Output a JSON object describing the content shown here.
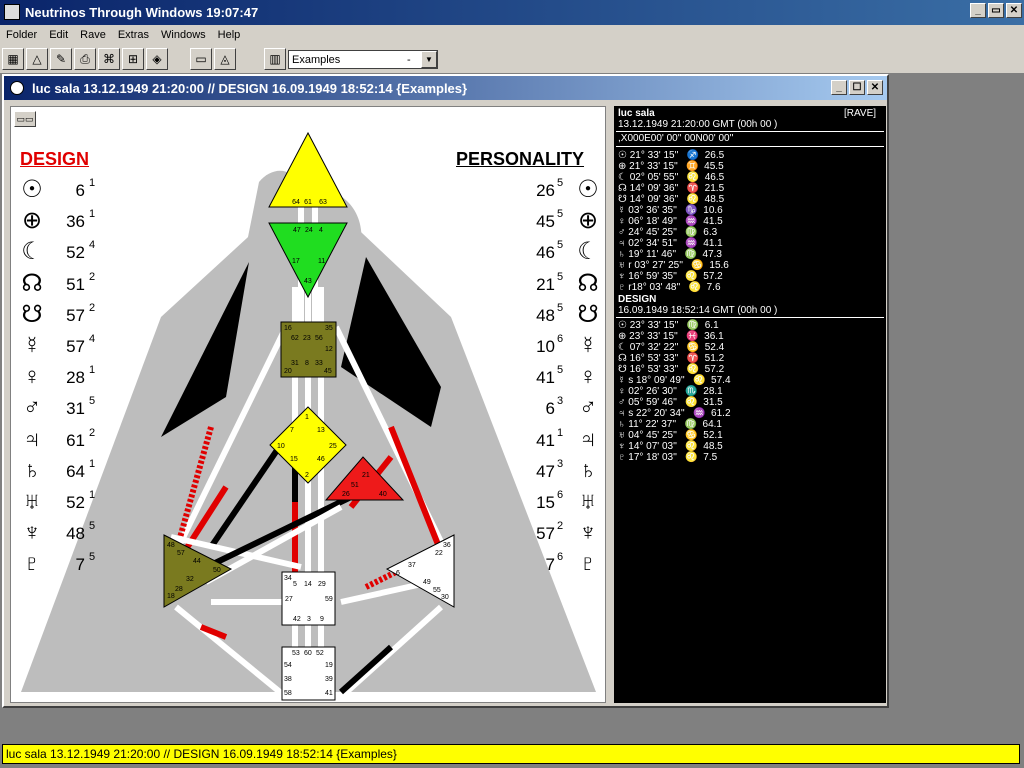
{
  "app": {
    "title": "Neutrinos Through Windows 19:07:47"
  },
  "menu": [
    "Folder",
    "Edit",
    "Rave",
    "Extras",
    "Windows",
    "Help"
  ],
  "toolbar": {
    "examples_value": "Examples",
    "examples_dash": "-"
  },
  "child": {
    "title": "luc sala 13.12.1949 21:20:00 // DESIGN 16.09.1949 18:52:14  {Examples}"
  },
  "chart": {
    "design_label": "DESIGN",
    "personality_label": "PERSONALITY",
    "design": [
      {
        "glyph": "sun-icon",
        "gate": "6",
        "line": "1"
      },
      {
        "glyph": "earth-icon",
        "gate": "36",
        "line": "1"
      },
      {
        "glyph": "moon-icon",
        "gate": "52",
        "line": "4"
      },
      {
        "glyph": "north-node-icon",
        "gate": "51",
        "line": "2"
      },
      {
        "glyph": "south-node-icon",
        "gate": "57",
        "line": "2"
      },
      {
        "glyph": "mercury-icon",
        "gate": "57",
        "line": "4"
      },
      {
        "glyph": "venus-icon",
        "gate": "28",
        "line": "1"
      },
      {
        "glyph": "mars-icon",
        "gate": "31",
        "line": "5"
      },
      {
        "glyph": "jupiter-icon",
        "gate": "61",
        "line": "2"
      },
      {
        "glyph": "saturn-icon",
        "gate": "64",
        "line": "1"
      },
      {
        "glyph": "uranus-icon",
        "gate": "52",
        "line": "1"
      },
      {
        "glyph": "neptune-icon",
        "gate": "48",
        "line": "5"
      },
      {
        "glyph": "pluto-icon",
        "gate": "7",
        "line": "5"
      }
    ],
    "personality": [
      {
        "glyph": "sun-icon",
        "gate": "26",
        "line": "5"
      },
      {
        "glyph": "earth-icon",
        "gate": "45",
        "line": "5"
      },
      {
        "glyph": "moon-icon",
        "gate": "46",
        "line": "5"
      },
      {
        "glyph": "north-node-icon",
        "gate": "21",
        "line": "5"
      },
      {
        "glyph": "south-node-icon",
        "gate": "48",
        "line": "5"
      },
      {
        "glyph": "mercury-icon",
        "gate": "10",
        "line": "6"
      },
      {
        "glyph": "venus-icon",
        "gate": "41",
        "line": "5"
      },
      {
        "glyph": "mars-icon",
        "gate": "6",
        "line": "3"
      },
      {
        "glyph": "jupiter-icon",
        "gate": "41",
        "line": "1"
      },
      {
        "glyph": "saturn-icon",
        "gate": "47",
        "line": "3"
      },
      {
        "glyph": "uranus-icon",
        "gate": "15",
        "line": "6"
      },
      {
        "glyph": "neptune-icon",
        "gate": "57",
        "line": "2"
      },
      {
        "glyph": "pluto-icon",
        "gate": "7",
        "line": "6"
      }
    ],
    "centers": {
      "head": [
        "64",
        "61",
        "63"
      ],
      "ajna": [
        "47",
        "24",
        "4",
        "17",
        "11",
        "43"
      ],
      "throat": [
        "16",
        "62",
        "23",
        "56",
        "35",
        "12",
        "31",
        "8",
        "33",
        "20",
        "45"
      ],
      "g": [
        "1",
        "7",
        "13",
        "10",
        "25",
        "15",
        "46",
        "2"
      ],
      "ego": [
        "21",
        "51",
        "26",
        "40"
      ],
      "spleen": [
        "48",
        "57",
        "44",
        "50",
        "32",
        "28",
        "18"
      ],
      "sacral": [
        "34",
        "5",
        "14",
        "29",
        "27",
        "59",
        "42",
        "3",
        "9"
      ],
      "solar": [
        "36",
        "22",
        "37",
        "6",
        "49",
        "55",
        "30"
      ],
      "root": [
        "53",
        "60",
        "52",
        "54",
        "19",
        "38",
        "39",
        "58",
        "41"
      ]
    }
  },
  "panel": {
    "name": "luc sala",
    "rave_tag": "[RAVE]",
    "personality_date": "13.12.1949  21:20:00  GMT (00h 00 )",
    "coords": ",X000E00' 00''  00N00' 00''",
    "personality_rows": [
      "21° 33' 15''   ♐  26.5",
      "21° 33' 15''   ♊  45.5",
      "02° 05' 55''   ♌  46.5",
      "14° 09' 36''   ♈  21.5",
      "14° 09' 36''   ♌  48.5",
      "03° 36' 35''   ♑  10.6",
      "06° 18' 49''   ♒  41.5",
      "24° 45' 25''   ♍  6.3",
      "02° 34' 51''   ♒  41.1",
      "19° 11' 46''   ♍  47.3",
      "r 03° 27' 25''   ♋  15.6",
      "16° 59' 35''   ♌  57.2",
      "r18° 03' 48''   ♌  7.6"
    ],
    "design_label": "DESIGN",
    "design_date": "16.09.1949  18:52:14  GMT (00h 00 )",
    "design_rows": [
      "23° 33' 15''   ♍  6.1",
      "23° 33' 15''   ♓  36.1",
      "07° 32' 22''   ♋  52.4",
      "16° 53' 33''   ♈  51.2",
      "16° 53' 33''   ♌  57.2",
      "s 18° 09' 49''   ♌  57.4",
      "02° 26' 30''   ♏  28.1",
      "05° 59' 46''   ♌  31.5",
      "s 22° 20' 34''   ♒  61.2",
      "11° 22' 37''   ♍  64.1",
      "04° 45' 25''   ♋  52.1",
      "14° 07' 03''   ♌  48.5",
      "17° 18' 03''   ♌  7.5"
    ]
  },
  "status": "luc sala 13.12.1949 21:20:00 // DESIGN 16.09.1949 18:52:14  {Examples}",
  "colors": {
    "ajna": "#20dd20",
    "head": "#ffff00",
    "throat": "#7a7a1f",
    "g": "#ffff00",
    "ego": "#ee1a1a",
    "spleen": "#7a7a1f",
    "defined_design": "#e00000"
  }
}
